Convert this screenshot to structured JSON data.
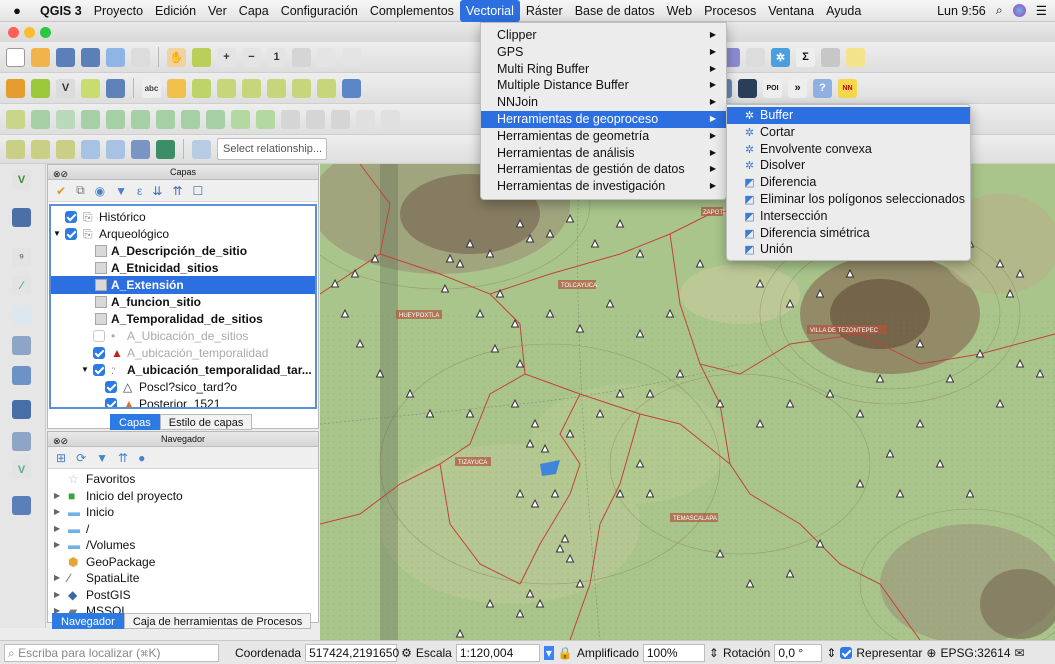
{
  "menubar": {
    "app": "QGIS 3",
    "items": [
      "Proyecto",
      "Edición",
      "Ver",
      "Capa",
      "Configuración",
      "Complementos",
      "Vectorial",
      "Ráster",
      "Base de datos",
      "Web",
      "Procesos",
      "Ventana",
      "Ayuda"
    ],
    "active_item": "Vectorial",
    "clock": "Lun 9:56"
  },
  "toolbar": {
    "select_relationship_placeholder": "Select relationship..."
  },
  "vectorial_menu": {
    "items": [
      {
        "label": "Clipper",
        "submenu": true
      },
      {
        "label": "GPS",
        "submenu": true
      },
      {
        "label": "Multi Ring Buffer",
        "submenu": true
      },
      {
        "label": "Multiple Distance Buffer",
        "submenu": true
      },
      {
        "label": "NNJoin",
        "submenu": true
      },
      {
        "label": "Herramientas de geoproceso",
        "submenu": true,
        "highlighted": true
      },
      {
        "label": "Herramientas de geometría",
        "submenu": true
      },
      {
        "label": "Herramientas de análisis",
        "submenu": true
      },
      {
        "label": "Herramientas de gestión de datos",
        "submenu": true
      },
      {
        "label": "Herramientas de investigación",
        "submenu": true
      }
    ]
  },
  "geoproceso_submenu": {
    "items": [
      {
        "label": "Buffer",
        "icon": "gear-icon",
        "highlighted": true
      },
      {
        "label": "Cortar",
        "icon": "gear-icon"
      },
      {
        "label": "Envolvente convexa",
        "icon": "gear-icon"
      },
      {
        "label": "Disolver",
        "icon": "gear-icon"
      },
      {
        "label": "Diferencia",
        "icon": "polygon-tool-icon"
      },
      {
        "label": "Eliminar los polígonos seleccionados",
        "icon": "polygon-tool-icon"
      },
      {
        "label": "Intersección",
        "icon": "polygon-tool-icon"
      },
      {
        "label": "Diferencia simétrica",
        "icon": "polygon-tool-icon"
      },
      {
        "label": "Unión",
        "icon": "polygon-tool-icon"
      }
    ]
  },
  "layers_panel": {
    "title": "Capas",
    "items": [
      {
        "label": "Histórico",
        "checked": true,
        "kind": "group",
        "indent": 0
      },
      {
        "label": "Arqueológico",
        "checked": true,
        "kind": "group",
        "indent": 0,
        "expanded": true
      },
      {
        "label": "A_Descripción_de_sitio",
        "kind": "table",
        "indent": 1,
        "bold": true
      },
      {
        "label": "A_Etnicidad_sitios",
        "kind": "table",
        "indent": 1,
        "bold": true
      },
      {
        "label": "A_Extensión",
        "kind": "table",
        "indent": 1,
        "bold": true,
        "selected": true
      },
      {
        "label": "A_funcion_sitio",
        "kind": "table",
        "indent": 1,
        "bold": true
      },
      {
        "label": "A_Temporalidad_de_sitios",
        "kind": "table",
        "indent": 1,
        "bold": true
      },
      {
        "label": "A_Ubicación_de_sitios",
        "checked": false,
        "kind": "point",
        "indent": 1,
        "grey": true
      },
      {
        "label": "A_ubicación_temporalidad",
        "checked": true,
        "kind": "red-triangle",
        "indent": 1,
        "grey": true
      },
      {
        "label": "A_ubicación_temporalidad_tar...",
        "checked": true,
        "kind": "categorized",
        "indent": 1,
        "bold": true,
        "expanded": true
      },
      {
        "label": "Poscl?sico_tard?o",
        "checked": true,
        "kind": "white-triangle",
        "indent": 2
      },
      {
        "label": "Posterior_1521",
        "checked": true,
        "kind": "orange-triangle",
        "indent": 2
      }
    ],
    "tabs": [
      "Capas",
      "Estilo de capas"
    ]
  },
  "browser_panel": {
    "title": "Navegador",
    "items": [
      {
        "label": "Favoritos",
        "icon": "star-icon"
      },
      {
        "label": "Inicio del proyecto",
        "icon": "project-icon"
      },
      {
        "label": "Inicio",
        "icon": "folder-icon"
      },
      {
        "label": "/",
        "icon": "folder-icon"
      },
      {
        "label": "/Volumes",
        "icon": "folder-icon"
      },
      {
        "label": "GeoPackage",
        "icon": "geopackage-icon"
      },
      {
        "label": "SpatiaLite",
        "icon": "spatialite-icon"
      },
      {
        "label": "PostGIS",
        "icon": "postgis-icon"
      },
      {
        "label": "MSSQL",
        "icon": "mssql-icon"
      }
    ],
    "tabs": [
      "Navegador",
      "Caja de herramientas de Procesos"
    ]
  },
  "map": {
    "place_labels": [
      "ZAPOTI",
      "TOLCAYUCA",
      "HUEYPOXTLA",
      "VILLA DE TEZONTEPEC",
      "TIZAYUCA",
      "TEMASCALAPA"
    ]
  },
  "statusbar": {
    "search_placeholder": "Escriba para localizar (⌘K)",
    "coord_label": "Coordenada",
    "coord_value": "517424,2191650",
    "scale_label": "Escala",
    "scale_value": "1:120,004",
    "magnifier_label": "Amplificado",
    "magnifier_value": "100%",
    "rotation_label": "Rotación",
    "rotation_value": "0,0 °",
    "render_label": "Representar",
    "crs": "EPSG:32614"
  }
}
